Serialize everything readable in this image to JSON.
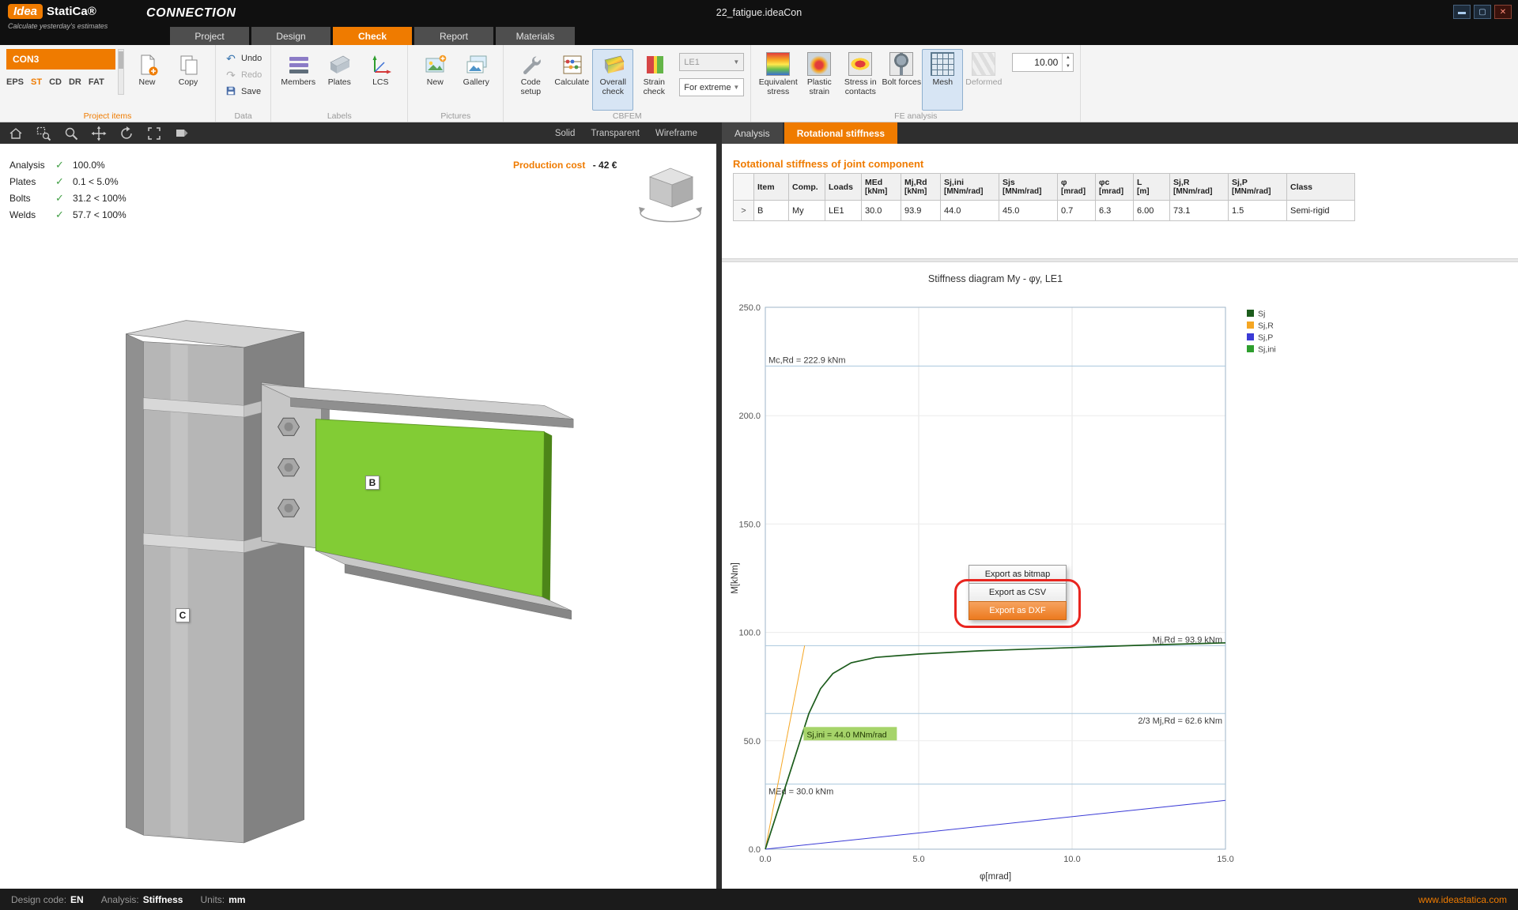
{
  "colors": {
    "accent": "#ef7b00",
    "model_plate_green": "#82cc35",
    "check_green": "#43a047",
    "callout_red": "#e8251f"
  },
  "titlebar": {
    "logo_primary": "Idea",
    "logo_secondary": "StatiCa®",
    "app_name": "CONNECTION",
    "tagline": "Calculate yesterday's estimates",
    "document_title": "22_fatigue.ideaCon"
  },
  "ribbon_tabs": {
    "items": [
      "Project",
      "Design",
      "Check",
      "Report",
      "Materials"
    ],
    "active": "Check"
  },
  "ribbon": {
    "project_items": {
      "group_label": "Project items",
      "selected_item": "CON3",
      "modes": [
        "EPS",
        "ST",
        "CD",
        "DR",
        "FAT"
      ],
      "active_mode": "ST",
      "new": "New",
      "copy": "Copy"
    },
    "data": {
      "group_label": "Data",
      "undo": "Undo",
      "redo": "Redo",
      "save": "Save"
    },
    "labels": {
      "group_label": "Labels",
      "members": "Members",
      "plates": "Plates",
      "lcs": "LCS"
    },
    "pictures": {
      "group_label": "Pictures",
      "new": "New",
      "gallery": "Gallery"
    },
    "cbfem": {
      "group_label": "CBFEM",
      "code_setup": "Code setup",
      "calculate": "Calculate",
      "overall_check": "Overall check",
      "strain_check": "Strain check",
      "load_effect": "LE1",
      "extreme": "For extreme"
    },
    "fe_analysis": {
      "group_label": "FE analysis",
      "buttons": [
        {
          "label": "Equivalent stress",
          "icon": "equivalent-stress",
          "state": "normal"
        },
        {
          "label": "Plastic strain",
          "icon": "plastic-strain",
          "state": "normal"
        },
        {
          "label": "Stress in contacts",
          "icon": "stress-contacts",
          "state": "normal"
        },
        {
          "label": "Bolt forces",
          "icon": "bolt-forces",
          "state": "normal"
        },
        {
          "label": "Mesh",
          "icon": "mesh",
          "state": "selected"
        },
        {
          "label": "Deformed",
          "icon": "deformed",
          "state": "disabled"
        }
      ],
      "scale_value": "10.00"
    }
  },
  "viewport": {
    "view_modes": [
      "Solid",
      "Transparent",
      "Wireframe"
    ],
    "checks": [
      {
        "name": "Analysis",
        "value": "100.0%"
      },
      {
        "name": "Plates",
        "value": "0.1 < 5.0%"
      },
      {
        "name": "Bolts",
        "value": "31.2 < 100%"
      },
      {
        "name": "Welds",
        "value": "57.7 < 100%"
      }
    ],
    "production_cost_label": "Production cost",
    "production_cost_value": "-  42 €",
    "member_b": "B",
    "member_c": "C"
  },
  "results": {
    "tabs": [
      "Analysis",
      "Rotational stiffness"
    ],
    "active_tab": "Rotational stiffness",
    "section_title": "Rotational stiffness of joint component",
    "table": {
      "columns": [
        {
          "name": "Item",
          "unit": ""
        },
        {
          "name": "Comp.",
          "unit": ""
        },
        {
          "name": "Loads",
          "unit": ""
        },
        {
          "name": "MEd",
          "unit": "[kNm]"
        },
        {
          "name": "Mj,Rd",
          "unit": "[kNm]"
        },
        {
          "name": "Sj,ini",
          "unit": "[MNm/rad]"
        },
        {
          "name": "Sjs",
          "unit": "[MNm/rad]"
        },
        {
          "name": "φ",
          "unit": "[mrad]"
        },
        {
          "name": "φc",
          "unit": "[mrad]"
        },
        {
          "name": "L",
          "unit": "[m]"
        },
        {
          "name": "Sj,R",
          "unit": "[MNm/rad]"
        },
        {
          "name": "Sj,P",
          "unit": "[MNm/rad]"
        },
        {
          "name": "Class",
          "unit": ""
        }
      ],
      "rows": [
        [
          "B",
          "My",
          "LE1",
          "30.0",
          "93.9",
          "44.0",
          "45.0",
          "0.7",
          "6.3",
          "6.00",
          "73.1",
          "1.5",
          "Semi-rigid"
        ]
      ]
    }
  },
  "chart_data": {
    "type": "line",
    "title": "Stiffness diagram My - φy, LE1",
    "xlabel": "φ[mrad]",
    "ylabel": "M[kNm]",
    "xlim": [
      0,
      15
    ],
    "ylim": [
      0,
      250
    ],
    "xticks": [
      0,
      5,
      10,
      15
    ],
    "yticks": [
      0,
      50,
      100,
      150,
      200,
      250
    ],
    "grid": true,
    "legend_position": "right-top",
    "series": [
      {
        "name": "Sj",
        "color": "#1c5c1c",
        "width": 1.7,
        "points": [
          [
            0,
            0
          ],
          [
            0.5,
            22
          ],
          [
            1.0,
            44
          ],
          [
            1.42,
            62.6
          ],
          [
            1.8,
            74
          ],
          [
            2.2,
            81
          ],
          [
            2.8,
            86
          ],
          [
            3.6,
            88.5
          ],
          [
            5,
            90
          ],
          [
            7,
            91.5
          ],
          [
            10,
            93
          ],
          [
            12.5,
            94.2
          ],
          [
            15,
            95.2
          ]
        ]
      },
      {
        "name": "Sj,R",
        "color": "#f5a623",
        "width": 1,
        "points": [
          [
            0,
            0
          ],
          [
            1.28,
            93.9
          ]
        ]
      },
      {
        "name": "Sj,P",
        "color": "#3b3bd6",
        "width": 1,
        "points": [
          [
            0,
            0
          ],
          [
            15,
            22.5
          ]
        ]
      },
      {
        "name": "Sj,ini",
        "color": "#2e9e2e",
        "width": 1.2,
        "points": [
          [
            0,
            0
          ],
          [
            1.42,
            62.6
          ]
        ]
      }
    ],
    "reference_lines": [
      {
        "label": "Mc,Rd = 222.9 kNm",
        "y": 222.9,
        "side": "left",
        "valign": "above"
      },
      {
        "label": "Mj,Rd = 93.9 kNm",
        "y": 93.9,
        "side": "right",
        "valign": "above"
      },
      {
        "label": "2/3 Mj,Rd = 62.6 kNm",
        "y": 62.6,
        "side": "right",
        "valign": "below"
      },
      {
        "label": "MEd = 30.0 kNm",
        "y": 30.0,
        "side": "left",
        "valign": "below"
      }
    ],
    "annotation": {
      "text": "Sj,ini = 44.0 MNm/rad",
      "x": 1.35,
      "y": 52,
      "bg": "#a6d46a"
    }
  },
  "context_menu": {
    "items": [
      {
        "label": "Export as bitmap",
        "highlighted": false
      },
      {
        "label": "Export as CSV",
        "highlighted": false
      },
      {
        "label": "Export as DXF",
        "highlighted": true
      }
    ]
  },
  "statusbar": {
    "design_code_label": "Design code:",
    "design_code_value": "EN",
    "analysis_label": "Analysis:",
    "analysis_value": "Stiffness",
    "units_label": "Units:",
    "units_value": "mm",
    "website": "www.ideastatica.com"
  }
}
